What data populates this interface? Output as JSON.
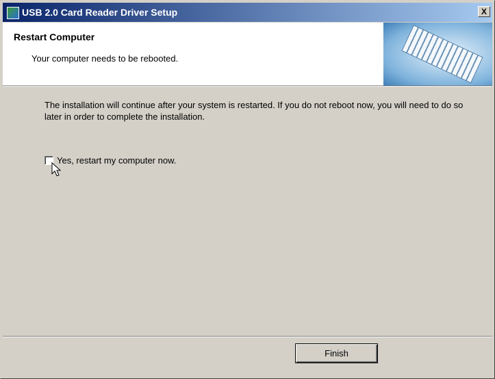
{
  "window": {
    "title": "USB 2.0 Card Reader Driver Setup",
    "close_label": "X"
  },
  "header": {
    "title": "Restart Computer",
    "subtitle": "Your computer needs to be rebooted."
  },
  "body": {
    "message": "The installation will continue after your system is restarted. If you do not reboot now, you will need to do so later in order to complete the installation.",
    "restart_checkbox": {
      "label": "Yes, restart my computer now.",
      "checked": false
    }
  },
  "footer": {
    "finish_label": "Finish"
  }
}
